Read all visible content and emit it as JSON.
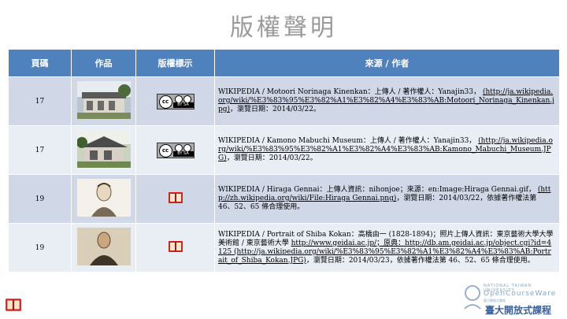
{
  "title": "版權聲明",
  "table": {
    "headers": [
      "頁碼",
      "作品",
      "版權標示",
      "來源 / 作者"
    ],
    "rows": [
      {
        "page": "17",
        "thumb": "house-photo-1",
        "license": "cc-by-sa",
        "src_text": "WIKIPEDIA / Motoori Norinaga Kinenkan：上傳人 / 著作權人：Yanajin33，",
        "src_link": "(http://ja.wikipedia.org/wiki/%E3%83%95%E3%82%A1%E3%82%A4%E3%83%AB:Motoori_Norinaga_Kinenkan.jpg)",
        "src_date": "，瀏覽日期：2014/03/22。"
      },
      {
        "page": "17",
        "thumb": "house-photo-2",
        "license": "cc-by-sa",
        "src_text": "WIKIPEDIA / Kamono Mabuchi Museum：上傳人 / 著作權人：Yanajin33，",
        "src_link": "(http://ja.wikipedia.org/wiki/%E3%83%95%E3%82%A1%E3%82%A4%E3%83%AB:Kamono_Mabuchi_Museum.JPG)",
        "src_date": "，瀏覽日期：2014/03/22。"
      },
      {
        "page": "19",
        "thumb": "portrait-1",
        "license": "public-domain",
        "src_text": "WIKIPEDIA / Hiraga Gennai：上傳人資訊：nihonjoe；來源：en:Image:Hiraga Gennai.gif，",
        "src_link": "(http://zh.wikipedia.org/wiki/File:Hiraga Gennai.png)",
        "src_date": "，瀏覽日期：2014/03/22，依據著作權法第 46、52、65 條合理使用。"
      },
      {
        "page": "19",
        "thumb": "portrait-2",
        "license": "public-domain",
        "src_text": "WIKIPEDIA / Portrait of Shiba Kokan：高橋由一 (1828-1894)；照片上傳人資訊：東京藝術大學大學美術館 / 東京藝術大學",
        "src_link": "http://www.geidai.ac.jp/；原典：http://db.am.geidai.ac.jp/object.cgi?id=4125 (http://ja.wikipedia.org/wiki/%E3%83%95%E3%82%A1%E3%82%A4%E3%83%AB:Portrait_of_Shiba_Kokan.JPG)",
        "src_date": "，瀏覽日期：2014/03/23，依據著作權法第 46、52、65 條合理使用。"
      }
    ]
  },
  "footer": {
    "logo_small": "NATIONAL TAIWAN UNIVERSITY",
    "logo_mid": "OpenCourseWare",
    "logo_sub": "臺大開放式課程",
    "logo_main": "臺大開放式課程"
  },
  "colors": {
    "header_bg": "#4f81bd",
    "row_dark": "#d0d8e8",
    "row_light": "#e9edf4",
    "public_domain_icon": "#cc2222"
  }
}
